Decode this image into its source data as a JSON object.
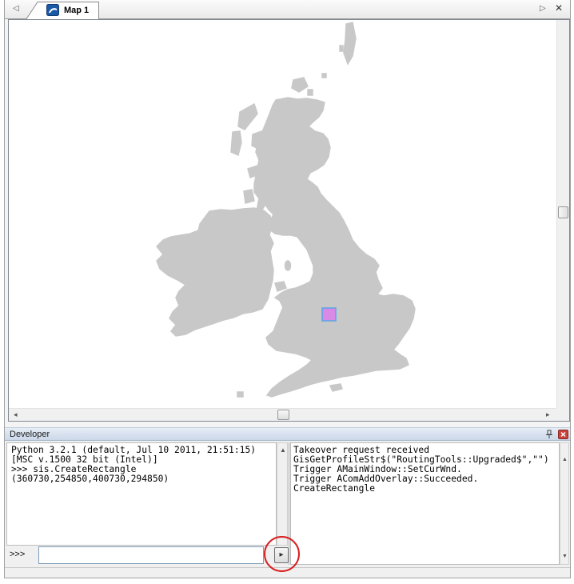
{
  "tabbar": {
    "scroll_left_glyph": "◁",
    "tab_label": "Map 1",
    "tab_icon": "map-app-icon",
    "scroll_right_glyph": "▷",
    "close_glyph": "✕"
  },
  "map": {
    "land_color": "#c8c8c8",
    "selection_fill": "#d98ae6",
    "selection_stroke": "#55a6e6",
    "hscroll_left_glyph": "◂",
    "hscroll_right_glyph": "▸"
  },
  "developer": {
    "title": "Developer",
    "pin_icon": "pin-icon",
    "close_icon": "close-icon",
    "console_scroll_up_glyph": "▲",
    "console_lines": [
      "Python 3.2.1 (default, Jul 10 2011, 21:51:15)",
      "[MSC v.1500 32 bit (Intel)]",
      ">>> sis.CreateRectangle",
      "(360730,254850,400730,294850)"
    ],
    "output_scroll_up_glyph": "▲",
    "output_scroll_down_glyph": "▼",
    "output_lines": [
      "Takeover request received",
      "GisGetProfileStr$(\"RoutingTools::Upgraded$\",\"\")",
      "Trigger AMainWindow::SetCurWnd.",
      "Trigger AComAddOverlay::Succeeded.",
      "CreateRectangle"
    ],
    "prompt": ">>>",
    "input_value": "",
    "input_placeholder": "",
    "run_glyph": "▸"
  },
  "colors": {
    "brand_blue": "#1a5aa5",
    "title_bar": "#cbd8e9",
    "close_red": "#c8413c",
    "highlight_ring": "#d81e1e"
  }
}
